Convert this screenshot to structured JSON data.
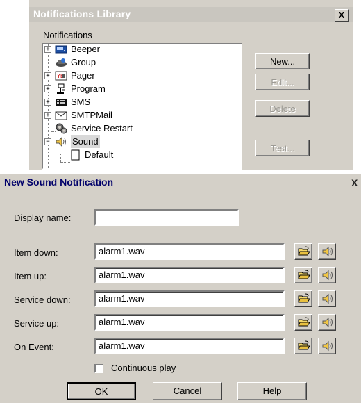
{
  "library": {
    "title": "Notifications Library",
    "close_label": "X",
    "group_label": "Notifications",
    "tree": [
      {
        "label": "Beeper",
        "icon": "beeper-icon",
        "expandable": true
      },
      {
        "label": "Group",
        "icon": "group-icon",
        "expandable": false
      },
      {
        "label": "Pager",
        "icon": "pager-icon",
        "expandable": true
      },
      {
        "label": "Program",
        "icon": "program-icon",
        "expandable": true
      },
      {
        "label": "SMS",
        "icon": "sms-icon",
        "expandable": true
      },
      {
        "label": "SMTPMail",
        "icon": "mail-icon",
        "expandable": true
      },
      {
        "label": "Service Restart",
        "icon": "service-restart-icon",
        "expandable": false
      },
      {
        "label": "Sound",
        "icon": "speaker-icon",
        "expandable": true,
        "expanded": true,
        "selected": true
      },
      {
        "label": "Default",
        "icon": "document-icon",
        "child": true
      }
    ],
    "buttons": {
      "new": "New...",
      "edit": "Edit...",
      "delete": "Delete",
      "test": "Test..."
    }
  },
  "dialog": {
    "title": "New Sound Notification",
    "close_label": "X",
    "display_name_label": "Display name:",
    "display_name_value": "",
    "rows": [
      {
        "label": "Item down:",
        "value": "alarm1.wav"
      },
      {
        "label": "Item up:",
        "value": "alarm1.wav"
      },
      {
        "label": "Service down:",
        "value": "alarm1.wav"
      },
      {
        "label": "Service up:",
        "value": "alarm1.wav"
      },
      {
        "label": "On Event:",
        "value": "alarm1.wav"
      }
    ],
    "continuous_play_label": "Continuous play",
    "continuous_play_checked": false,
    "ok_label": "OK",
    "cancel_label": "Cancel",
    "help_label": "Help"
  }
}
